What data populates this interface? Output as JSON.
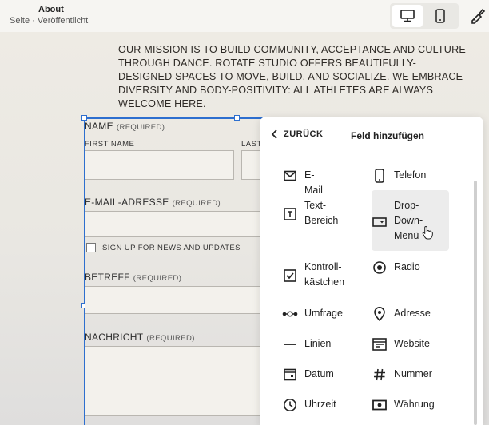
{
  "topbar": {
    "title": "About",
    "subtitle": "Seite · Veröffentlicht",
    "view_desktop": "desktop-icon",
    "view_mobile": "mobile-icon",
    "design_tool": "paintbrush-icon"
  },
  "mission": "OUR MISSION IS TO BUILD COMMUNITY, ACCEPTANCE AND CULTURE THROUGH DANCE. ROTATE STUDIO OFFERS BEAUTIFULLY-DESIGNED SPACES TO MOVE, BUILD, AND SOCIALIZE. WE EMBRACE DIVERSITY AND BODY-POSITIVITY: ALL ATHLETES ARE ALWAYS WELCOME HERE.",
  "form": {
    "name_label": "NAME",
    "name_required": "(REQUIRED)",
    "first_name": "FIRST NAME",
    "last_name": "LAST",
    "email_label": "E-MAIL-ADRESSE",
    "email_required": "(REQUIRED)",
    "newsletter": "SIGN UP FOR NEWS AND UPDATES",
    "subject_label": "BETREFF",
    "subject_required": "(REQUIRED)",
    "message_label": "NACHRICHT",
    "message_required": "(REQUIRED)"
  },
  "panel": {
    "back": "ZURÜCK",
    "title": "Feld hinzufügen",
    "items": [
      {
        "label": "E-Mail",
        "icon": "mail-icon"
      },
      {
        "label": "Telefon",
        "icon": "phone-icon"
      },
      {
        "label": "Text-\nBereich",
        "icon": "textarea-icon"
      },
      {
        "label": "Drop-\nDown-\nMenü",
        "icon": "dropdown-icon"
      },
      {
        "label": "Kontroll-\nkästchen",
        "icon": "checkbox-icon"
      },
      {
        "label": "Radio",
        "icon": "radio-icon"
      },
      {
        "label": "Umfrage",
        "icon": "survey-icon"
      },
      {
        "label": "Adresse",
        "icon": "location-pin-icon"
      },
      {
        "label": "Linien",
        "icon": "line-icon"
      },
      {
        "label": "Website",
        "icon": "website-icon"
      },
      {
        "label": "Datum",
        "icon": "calendar-icon"
      },
      {
        "label": "Nummer",
        "icon": "hash-icon"
      },
      {
        "label": "Uhrzeit",
        "icon": "clock-icon"
      },
      {
        "label": "Währung",
        "icon": "currency-icon"
      }
    ]
  }
}
